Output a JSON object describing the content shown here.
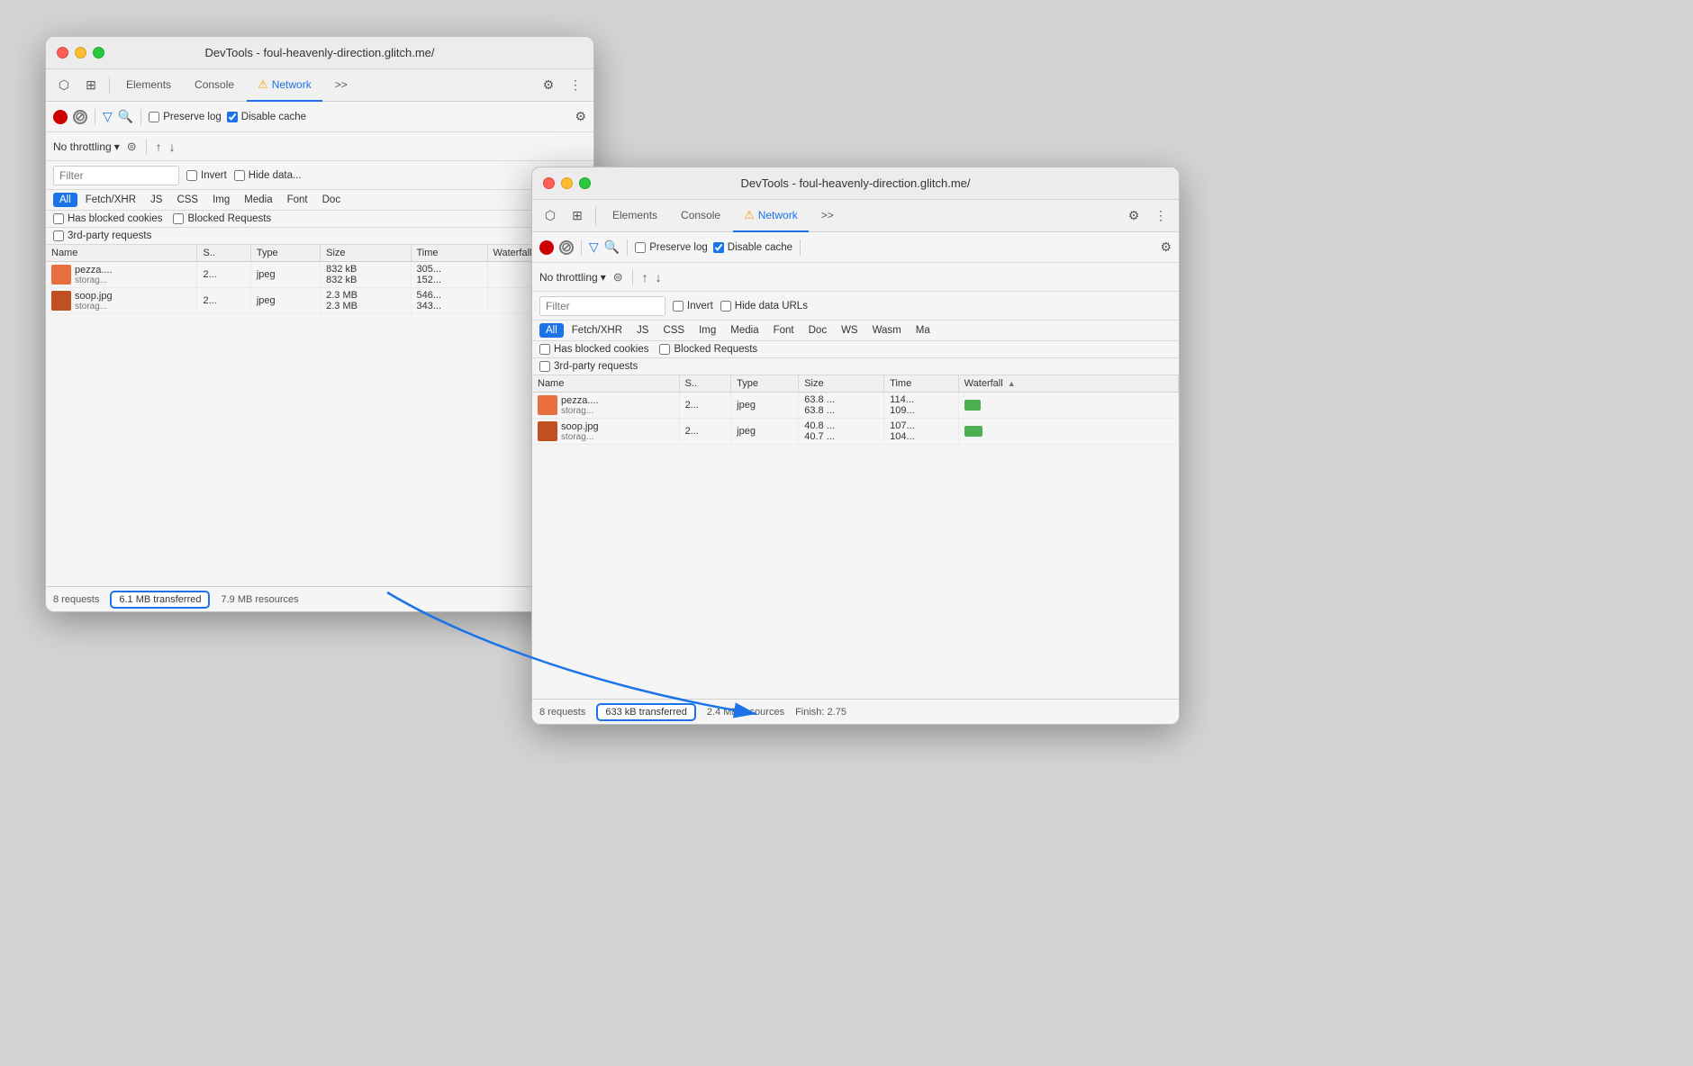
{
  "window1": {
    "title": "DevTools - foul-heavenly-direction.glitch.me/",
    "tabs": [
      "Elements",
      "Console",
      "Network",
      ">>"
    ],
    "active_tab": "Network",
    "record_label": "Record",
    "clear_label": "Clear",
    "preserve_log_label": "Preserve log",
    "disable_cache_label": "Disable cache",
    "no_throttling_label": "No throttling",
    "filter_placeholder": "Filter",
    "invert_label": "Invert",
    "hide_data_label": "Hide data...",
    "type_filters": [
      "All",
      "Fetch/XHR",
      "JS",
      "CSS",
      "Img",
      "Media",
      "Font",
      "Doc"
    ],
    "active_type": "All",
    "has_blocked_cookies": "Has blocked cookies",
    "blocked_requests": "Blocked Requests",
    "third_party": "3rd-party requests",
    "table": {
      "headers": [
        "Name",
        "S..",
        "Type",
        "Size",
        "Time",
        "Waterfall"
      ],
      "rows": [
        {
          "icon_color": "#e87040",
          "name": "pezza....",
          "url": "storag...",
          "status": "2...",
          "type": "jpeg",
          "size": "832 kB",
          "size2": "832 kB",
          "time": "305...",
          "time2": "152..."
        },
        {
          "icon_color": "#c05020",
          "name": "soop.jpg",
          "url": "storag...",
          "status": "2...",
          "type": "jpeg",
          "size": "2.3 MB",
          "size2": "2.3 MB",
          "time": "546...",
          "time2": "343..."
        }
      ]
    },
    "status": {
      "requests": "8 requests",
      "transferred": "6.1 MB transferred",
      "resources": "7.9 MB resources"
    }
  },
  "window2": {
    "title": "DevTools - foul-heavenly-direction.glitch.me/",
    "tabs": [
      "Elements",
      "Console",
      "Network",
      ">>"
    ],
    "active_tab": "Network",
    "preserve_log_label": "Preserve log",
    "disable_cache_label": "Disable cache",
    "no_throttling_label": "No throttling",
    "filter_placeholder": "Filter",
    "invert_label": "Invert",
    "hide_data_label": "Hide data URLs",
    "type_filters": [
      "All",
      "Fetch/XHR",
      "JS",
      "CSS",
      "Img",
      "Media",
      "Font",
      "Doc",
      "WS",
      "Wasm",
      "Ma"
    ],
    "active_type": "All",
    "has_blocked_cookies": "Has blocked cookies",
    "blocked_requests": "Blocked Requests",
    "third_party": "3rd-party requests",
    "table": {
      "headers": [
        "Name",
        "S..",
        "Type",
        "Size",
        "Time",
        "Waterfall"
      ],
      "rows": [
        {
          "icon_color": "#e87040",
          "name": "pezza....",
          "url": "storag...",
          "status": "2...",
          "type": "jpeg",
          "size": "63.8 ...",
          "size2": "63.8 ...",
          "time": "114...",
          "time2": "109...",
          "waterfall_width": 18,
          "waterfall_color": "#4caf50"
        },
        {
          "icon_color": "#c05020",
          "name": "soop.jpg",
          "url": "storag...",
          "status": "2...",
          "type": "jpeg",
          "size": "40.8 ...",
          "size2": "40.7 ...",
          "time": "107...",
          "time2": "104...",
          "waterfall_width": 20,
          "waterfall_color": "#4caf50"
        }
      ]
    },
    "status": {
      "requests": "8 requests",
      "transferred": "633 kB transferred",
      "resources": "2.4 MB resources",
      "finish": "Finish: 2.75"
    }
  },
  "icons": {
    "cursor": "⬡",
    "layers": "⊞",
    "gear": "⚙",
    "more": "⋮",
    "record_stop": "●",
    "clear": "⊘",
    "filter": "▽",
    "search": "🔍",
    "chevron_down": "▾",
    "upload": "↑",
    "download": "↓",
    "wifi": "⊜",
    "sort_asc": "▲"
  }
}
